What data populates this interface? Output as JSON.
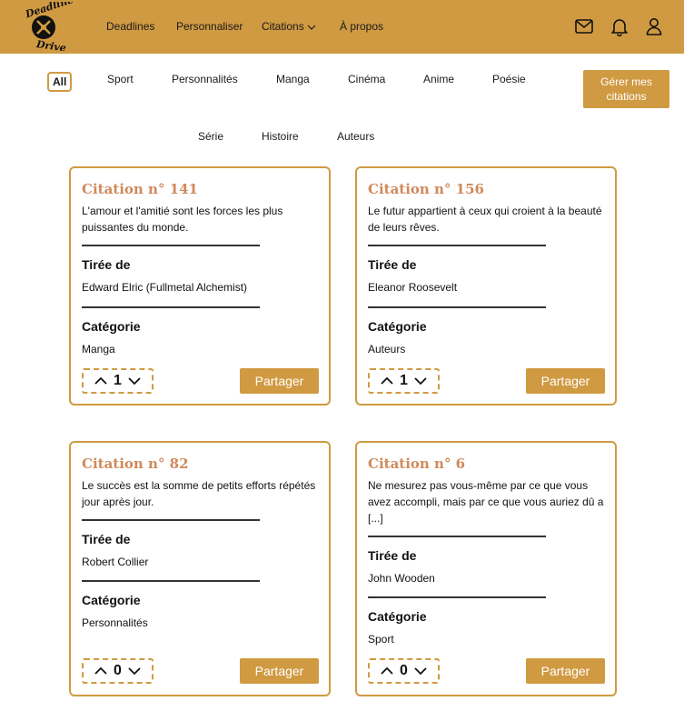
{
  "brand": {
    "logo_text_top": "Deadline",
    "logo_text_bottom": "Drive"
  },
  "nav": {
    "items": [
      "Deadlines",
      "Personnaliser",
      "Citations",
      "À propos"
    ],
    "icons": [
      "mail-icon",
      "bell-icon",
      "user-icon"
    ]
  },
  "filters": {
    "row1": [
      "All",
      "Sport",
      "Personnalités",
      "Manga",
      "Cinéma",
      "Anime",
      "Poésie"
    ],
    "row2": [
      "Série",
      "Histoire",
      "Auteurs"
    ],
    "active": "All"
  },
  "manage_button": {
    "line1": "Gérer mes",
    "line2": "citations"
  },
  "colors": {
    "accent": "#d09a42",
    "title": "#cf8a5b"
  },
  "cards": [
    {
      "title": "Citation n° 141",
      "quote": "L'amour et l'amitié sont les forces les plus puissantes du monde.",
      "source_label": "Tirée de",
      "source": "Edward Elric (Fullmetal Alchemist)",
      "category_label": "Catégorie",
      "category": "Manga",
      "votes": "1",
      "share_label": "Partager"
    },
    {
      "title": "Citation n° 156",
      "quote": "Le futur appartient à ceux qui croient à la beauté de leurs rêves.",
      "source_label": "Tirée de",
      "source": "Eleanor Roosevelt",
      "category_label": "Catégorie",
      "category": "Auteurs",
      "votes": "1",
      "share_label": "Partager"
    },
    {
      "title": "Citation n° 82",
      "quote": "Le succès est la somme de petits efforts répétés jour après jour.",
      "source_label": "Tirée de",
      "source": "Robert Collier",
      "category_label": "Catégorie",
      "category": "Personnalités",
      "votes": "0",
      "share_label": "Partager"
    },
    {
      "title": "Citation n° 6",
      "quote": "Ne mesurez pas vous-même par ce que vous avez accompli, mais par ce que vous auriez dû a [...]",
      "source_label": "Tirée de",
      "source": "John Wooden",
      "category_label": "Catégorie",
      "category": "Sport",
      "votes": "0",
      "share_label": "Partager"
    }
  ]
}
